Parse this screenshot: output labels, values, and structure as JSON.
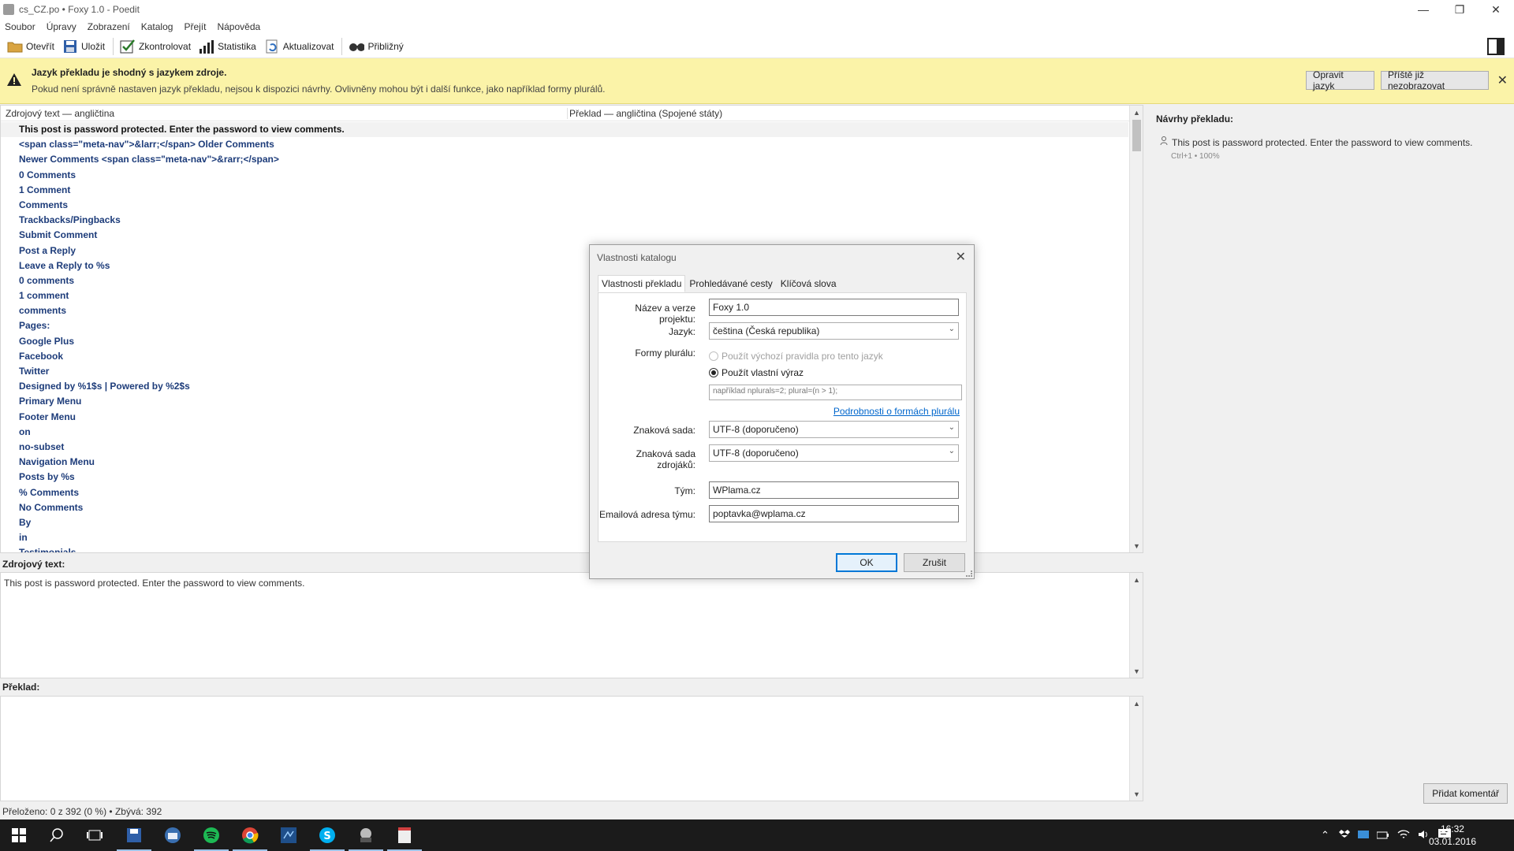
{
  "window": {
    "title": "cs_CZ.po • Foxy 1.0 - Poedit"
  },
  "menu": [
    "Soubor",
    "Úpravy",
    "Zobrazení",
    "Katalog",
    "Přejít",
    "Nápověda"
  ],
  "toolbar": {
    "open": "Otevřít",
    "save": "Uložit",
    "validate": "Zkontrolovat",
    "stats": "Statistika",
    "update": "Aktualizovat",
    "fuzzy": "Přibližný"
  },
  "warning": {
    "title": "Jazyk překladu je shodný s jazykem zdroje.",
    "text": "Pokud není správně nastaven jazyk překladu, nejsou k dispozici návrhy. Ovlivněny mohou být i další funkce, jako například formy plurálů.",
    "fix_button": "Opravit jazyk",
    "dismiss_button": "Příště již nezobrazovat"
  },
  "list": {
    "col_source": "Zdrojový text — angličtina",
    "col_translation": "Překlad — angličtina (Spojené státy)",
    "rows": [
      "This post is password protected. Enter the password to view comments.",
      "<span class=\"meta-nav\">&larr;</span> Older Comments",
      "Newer Comments <span class=\"meta-nav\">&rarr;</span>",
      "0 Comments",
      "1 Comment",
      "Comments",
      "Trackbacks/Pingbacks",
      "Submit Comment",
      "Post a Reply",
      "Leave a Reply to %s",
      "0 comments",
      "1 comment",
      "comments",
      "Pages:",
      "Google Plus",
      "Facebook",
      "Twitter",
      "Designed by %1$s | Powered by %2$s",
      "Primary Menu",
      "Footer Menu",
      "on",
      "no-subset",
      "Navigation Menu",
      "Posts by %s",
      "% Comments",
      "No Comments",
      "By",
      "in",
      "Testimonials"
    ]
  },
  "source_panel": {
    "label": "Zdrojový text:",
    "text": "This post is password protected. Enter the password to view comments."
  },
  "translation_panel": {
    "label": "Překlad:"
  },
  "suggestions": {
    "title": "Návrhy překladu:",
    "item": "This post is password protected. Enter the password to view comments.",
    "meta": "Ctrl+1 • 100%",
    "add_comment": "Přidat komentář"
  },
  "status": {
    "text": "Přeloženo: 0 z 392 (0 %)  •  Zbývá: 392"
  },
  "taskbar": {
    "time": "16:32",
    "date": "03.01.2016"
  },
  "dialog": {
    "title": "Vlastnosti katalogu",
    "tabs": [
      "Vlastnosti překladu",
      "Prohledávané cesty",
      "Klíčová slova"
    ],
    "project_label": "Název a verze projektu:",
    "project_value": "Foxy 1.0",
    "language_label": "Jazyk:",
    "language_value": "čeština (Česká republika)",
    "plural_label": "Formy plurálu:",
    "plural_default": "Použít výchozí pravidla pro tento jazyk",
    "plural_custom": "Použít vlastní výraz",
    "plural_placeholder": "například nplurals=2; plural=(n > 1);",
    "plural_link": "Podrobnosti o formách plurálu",
    "charset_label": "Znaková sada:",
    "charset_value": "UTF-8 (doporučeno)",
    "source_charset_label": "Znaková sada zdrojáků:",
    "source_charset_value": "UTF-8 (doporučeno)",
    "team_label": "Tým:",
    "team_value": "WPlama.cz",
    "team_email_label": "Emailová adresa týmu:",
    "team_email_value": "poptavka@wplama.cz",
    "ok": "OK",
    "cancel": "Zrušit"
  },
  "colors": {
    "warning_bg": "#fbf3a8",
    "list_text": "#1d3c7a",
    "accent": "#0078d7"
  }
}
